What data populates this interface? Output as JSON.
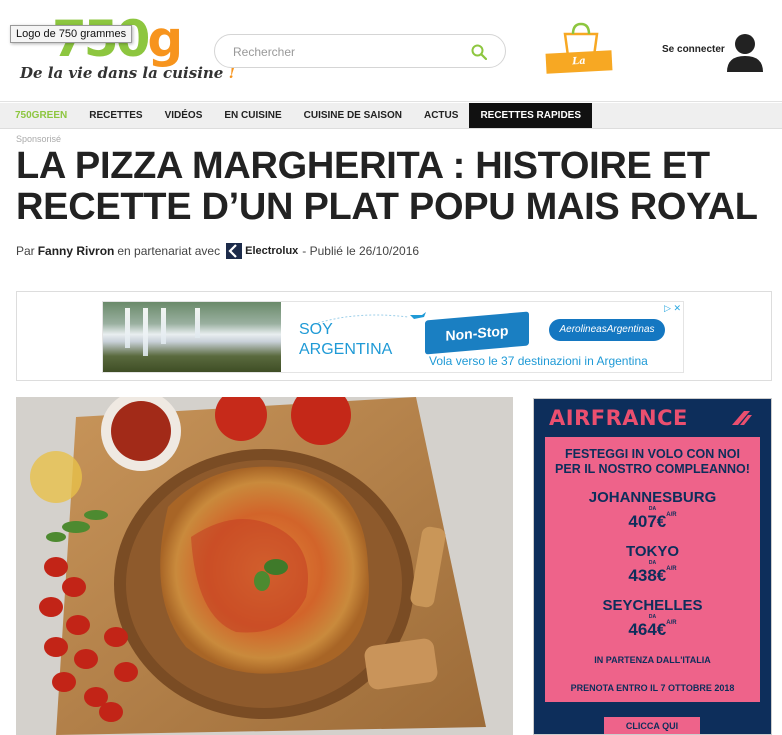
{
  "header": {
    "logo_text": "750g",
    "tagline": "De la vie dans la cuisine",
    "tagline_mark": "!",
    "logo_tooltip": "Logo de 750 grammes",
    "search_placeholder": "Rechercher",
    "shop_label": "La Boutique",
    "login_label": "Se connecter"
  },
  "nav": {
    "items": [
      "750GREEN",
      "RECETTES",
      "VIDÉOS",
      "EN CUISINE",
      "CUISINE DE SAISON",
      "ACTUS",
      "RECETTES RAPIDES"
    ]
  },
  "article": {
    "sponsor_label": "Sponsorisé",
    "title": "LA PIZZA MARGHERITA : HISTOIRE ET RECETTE D’UN PLAT POPU MAIS ROYAL",
    "by_prefix": "Par",
    "author": "Fanny Rivron",
    "partner_text": "en partenariat avec",
    "partner_name": "Electrolux",
    "published": "- Publié le 26/10/2016"
  },
  "banner_ad": {
    "line1": "SOY",
    "line2": "ARGENTINA",
    "badge": "Non-Stop",
    "airline": "AerolineasArgentinas",
    "sub": "Vola verso le 37 destinazioni in Argentina"
  },
  "side_ad": {
    "brand": "AIRFRANCE",
    "headline_1": "FESTEGGI IN VOLO CON NOI",
    "headline_2": "PER IL NOSTRO COMPLEANNO!",
    "da": "DA",
    "ar": "A/R",
    "destinations": [
      {
        "city": "JOHANNESBURG",
        "price": "407€"
      },
      {
        "city": "TOKYO",
        "price": "438€"
      },
      {
        "city": "SEYCHELLES",
        "price": "464€"
      }
    ],
    "departure": "IN PARTENZA DALL'ITALIA",
    "deadline": "PRENOTA ENTRO IL 7 OTTOBRE 2018",
    "cta": "CLICCA QUI"
  },
  "colors": {
    "brand_green": "#8dc63f",
    "brand_orange": "#f7941d",
    "airfrance_navy": "#0d2e5b",
    "airfrance_pink": "#ee638a"
  }
}
